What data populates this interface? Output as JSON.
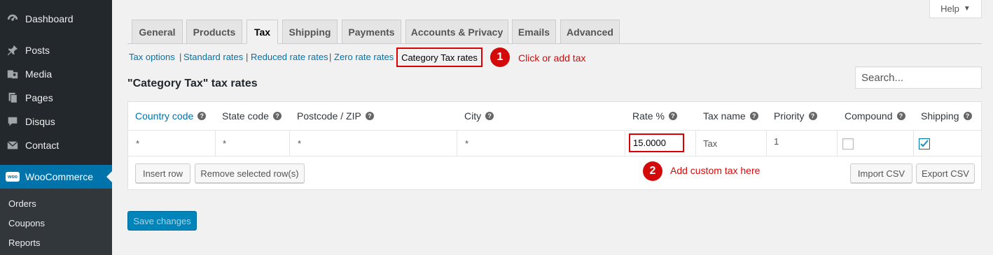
{
  "sidebar": {
    "items": [
      {
        "label": "Dashboard",
        "icon": "dashboard-icon"
      },
      {
        "label": "Posts",
        "icon": "pin-icon"
      },
      {
        "label": "Media",
        "icon": "media-icon"
      },
      {
        "label": "Pages",
        "icon": "pages-icon"
      },
      {
        "label": "Disqus",
        "icon": "comment-icon"
      },
      {
        "label": "Contact",
        "icon": "mail-icon"
      },
      {
        "label": "WooCommerce",
        "icon": "woo-icon",
        "badge": "woo"
      }
    ],
    "submenu": [
      "Orders",
      "Coupons",
      "Reports"
    ]
  },
  "help": {
    "label": "Help"
  },
  "tabs": [
    "General",
    "Products",
    "Tax",
    "Shipping",
    "Payments",
    "Accounts & Privacy",
    "Emails",
    "Advanced"
  ],
  "subsub": {
    "links": [
      "Tax options",
      "Standard rates",
      "Reduced rate rates",
      "Zero rate rates"
    ],
    "current": "Category Tax rates",
    "separator": "|"
  },
  "annotations": {
    "one": {
      "number": "1",
      "text": "Click or add tax"
    },
    "two": {
      "number": "2",
      "text": "Add custom tax here"
    }
  },
  "heading": "\"Category Tax\" tax rates",
  "search": {
    "placeholder": "Search..."
  },
  "table": {
    "headers": [
      "Country code",
      "State code",
      "Postcode / ZIP",
      "City",
      "Rate %",
      "Tax name",
      "Priority",
      "Compound",
      "Shipping"
    ],
    "help_glyph": "?",
    "row": {
      "country": "*",
      "state": "*",
      "postcode": "*",
      "city": "*",
      "rate": "15.0000",
      "tax_name": "Tax",
      "priority": "1",
      "compound": false,
      "shipping": true
    },
    "buttons": {
      "insert": "Insert row",
      "remove": "Remove selected row(s)",
      "import": "Import CSV",
      "export": "Export CSV"
    }
  },
  "save": {
    "label": "Save changes"
  },
  "colors": {
    "sidebar": "#23282d",
    "accent": "#0073aa",
    "annotation": "#d40a0a"
  }
}
